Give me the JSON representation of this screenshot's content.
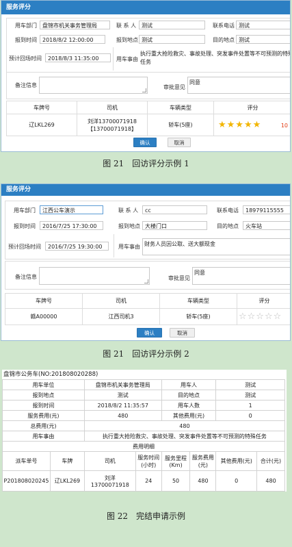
{
  "panel1": {
    "title": "服务评分",
    "dept_label": "用车部门",
    "dept_value": "盘锦市机关事务管理局",
    "contact_label": "联 系 人",
    "contact_value": "测试",
    "phone_label": "联系电话",
    "phone_value": "测试",
    "arrive_time_label": "报到时间",
    "arrive_time_value": "2018/8/2 12:00:00",
    "arrive_place_label": "报到地点",
    "arrive_place_value": "测试",
    "dest_label": "目的地点",
    "dest_value": "测试",
    "return_label": "预计回场时间",
    "return_value": "2018/8/3 11:35:00",
    "reason_label": "用车事由",
    "reason_value": "执行重大抢险救灾、事故处理、突发事件处置等不可预测的特殊",
    "reason_value2": "任务",
    "remark_label": "备注信息",
    "remark_value": "",
    "approval_label": "审批意见",
    "approval_value": "同意",
    "table_headers": [
      "车牌号",
      "司机",
      "车辆类型",
      "评分"
    ],
    "row": {
      "plate": "辽LKL269",
      "driver_line1": "刘洋13700071918",
      "driver_line2": "【13700071918】",
      "car_type": "轿车(5座)",
      "stars": "★★★★★",
      "score": "10"
    },
    "confirm": "确认",
    "cancel": "取消"
  },
  "caption1": "图 21　回访评分示例 1",
  "panel2": {
    "title": "服务评分",
    "dept_label": "用车部门",
    "dept_value": "江西公车演示",
    "contact_label": "联 系 人",
    "contact_value": "cc",
    "phone_label": "联系电话",
    "phone_value": "18979115555",
    "arrive_time_label": "报到时间",
    "arrive_time_value": "2016/7/25 17:30:00",
    "arrive_place_label": "报到地点",
    "arrive_place_value": "大楼门口",
    "dest_label": "目的地点",
    "dest_value": "火车站",
    "return_label": "预计回场时间",
    "return_value": "2016/7/25 19:30:00",
    "reason_label": "用车事由",
    "reason_value": "财务人员因公取、送大额现金",
    "remark_label": "备注信息",
    "remark_value": "",
    "approval_label": "审批意见",
    "approval_value": "同意",
    "table_headers": [
      "车牌号",
      "司机",
      "车辆类型",
      "评分"
    ],
    "row": {
      "plate": "赣A00000",
      "driver": "江西司机3",
      "car_type": "轿车(5座)",
      "stars": "☆☆☆☆☆"
    },
    "confirm": "确认",
    "cancel": "取消"
  },
  "caption2": "图 21　回访评分示例 2",
  "form": {
    "title": "盘锦市公务车(NO:201808020288)",
    "unit_label": "用车单位",
    "unit_value": "盘锦市机关事务管理局",
    "user_label": "用车人",
    "user_value": "测试",
    "arrive_place_label": "报到地点",
    "arrive_place_value": "测试",
    "dest_label": "目的地点",
    "dest_value": "测试",
    "arrive_time_label": "报到时间",
    "arrive_time_value": "2018/8/2 11:35:57",
    "people_label": "用车人数",
    "people_value": "1",
    "service_fee_label": "服务费用(元)",
    "service_fee_value": "480",
    "other_fee_label": "其他费用(元)",
    "other_fee_value": "0",
    "total_label": "总费用(元)",
    "total_value": "480",
    "reason_label": "用车事由",
    "reason_value": "执行重大抢险救灾、事故处理、突发事件处置等不可预测的特殊任务",
    "detail_title": "费用明细",
    "detail_headers": [
      "派车单号",
      "车牌",
      "司机",
      "服务时间(小时)",
      "服务里程(Km)",
      "服务费用(元)",
      "其他费用(元)",
      "合计(元)"
    ],
    "detail_row": {
      "order": "P201808020245",
      "plate": "辽LKL269",
      "driver_name": "刘洋",
      "driver_phone": "13700071918",
      "hours": "24",
      "km": "50",
      "fee": "480",
      "other": "0",
      "total": "480"
    }
  },
  "caption3": "图 22　完结申请示例"
}
